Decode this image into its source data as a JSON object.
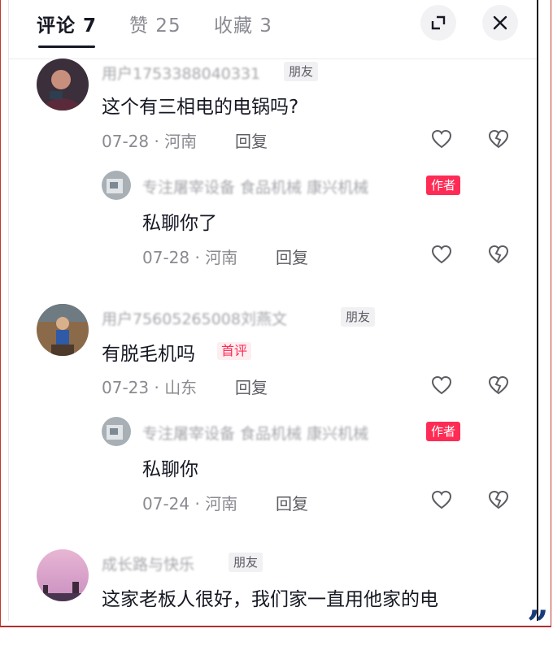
{
  "tabs": {
    "comments": "评论 7",
    "likes": "赞 25",
    "favorites": "收藏 3"
  },
  "comments": [
    {
      "username": "用户1753388040331",
      "tag": "朋友",
      "text": "这个有三相电的电锅吗?",
      "meta": "07-28 · 河南",
      "reply_label": "回复",
      "reply": {
        "username": "专注屠宰设备 食品机械 康兴机械",
        "tag": "作者",
        "text": "私聊你了",
        "meta": "07-28 · 河南",
        "reply_label": "回复"
      }
    },
    {
      "username": "用户75605265008刘燕文",
      "tag": "朋友",
      "text": "有脱毛机吗",
      "badge": "首评",
      "meta": "07-23 · 山东",
      "reply_label": "回复",
      "reply": {
        "username": "专注屠宰设备 食品机械 康兴机械",
        "tag": "作者",
        "text": "私聊你",
        "meta": "07-24 · 河南",
        "reply_label": "回复"
      }
    },
    {
      "username": "成长路与快乐",
      "tag": "朋友",
      "text": "这家老板人很好，我们家一直用他家的电"
    }
  ],
  "decor_quote": "”",
  "colors": {
    "accent": "#fe2c55",
    "text": "#161823",
    "muted": "#8a8b91"
  }
}
